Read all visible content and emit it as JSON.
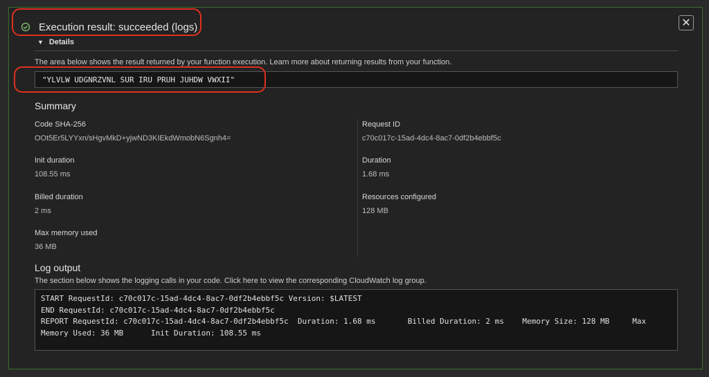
{
  "header": {
    "title": "Execution result: succeeded (logs)",
    "status": "success",
    "accent": "#7ab36a"
  },
  "details": {
    "toggle_label": "Details",
    "description": "The area below shows the result returned by your function execution. Learn more about returning results from your function.",
    "result": "\"YLVLW UDGNRZVNL SUR IRU PRUH JUHDW VWXII\""
  },
  "summary": {
    "title": "Summary",
    "fields": [
      {
        "label": "Code SHA-256",
        "value": "OOt5Er5LYYxn/sHgvMkD+yjwND3KIEkdWmobN6Sgnh4="
      },
      {
        "label": "Request ID",
        "value": "c70c017c-15ad-4dc4-8ac7-0df2b4ebbf5c"
      },
      {
        "label": "Init duration",
        "value": "108.55 ms"
      },
      {
        "label": "Duration",
        "value": "1.68 ms"
      },
      {
        "label": "Billed duration",
        "value": "2 ms"
      },
      {
        "label": "Resources configured",
        "value": "128 MB"
      },
      {
        "label": "Max memory used",
        "value": "36 MB"
      }
    ]
  },
  "log": {
    "title": "Log output",
    "description": "The section below shows the logging calls in your code. Click here to view the corresponding CloudWatch log group.",
    "lines": [
      "START RequestId: c70c017c-15ad-4dc4-8ac7-0df2b4ebbf5c Version: $LATEST",
      "END RequestId: c70c017c-15ad-4dc4-8ac7-0df2b4ebbf5c",
      "REPORT RequestId: c70c017c-15ad-4dc4-8ac7-0df2b4ebbf5c  Duration: 1.68 ms       Billed Duration: 2 ms    Memory Size: 128 MB     Max",
      "Memory Used: 36 MB      Init Duration: 108.55 ms"
    ]
  }
}
